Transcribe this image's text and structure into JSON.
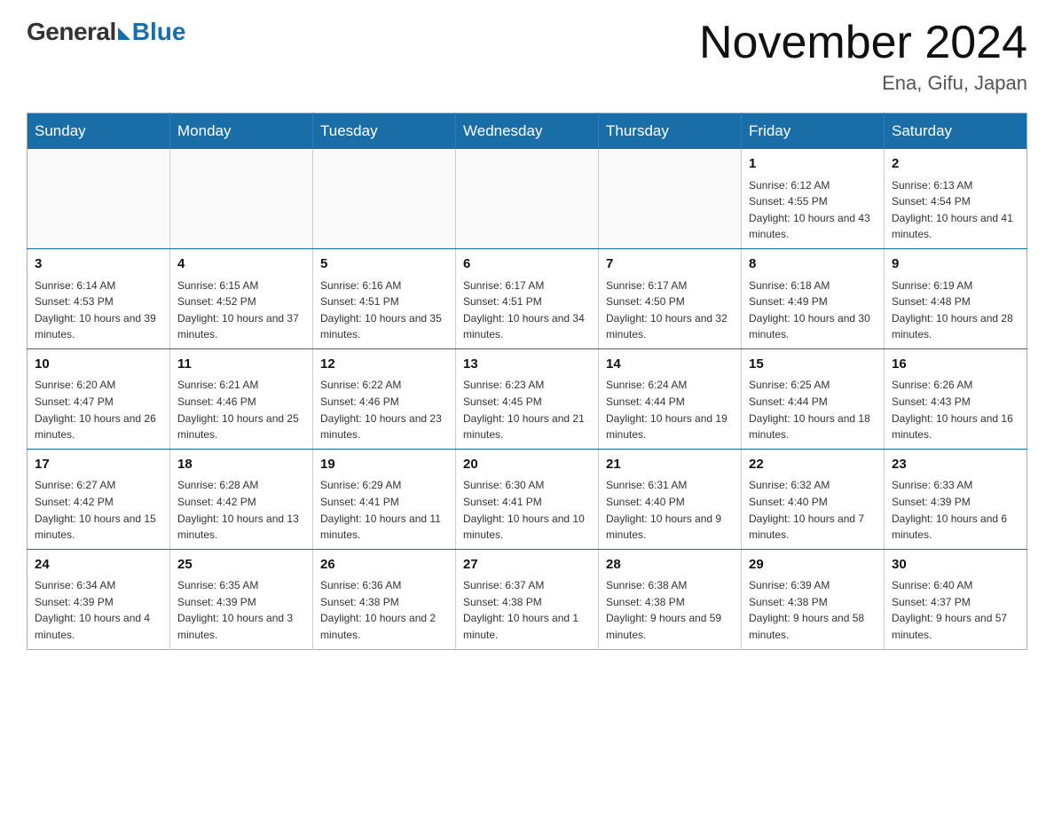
{
  "header": {
    "logo_general": "General",
    "logo_blue": "Blue",
    "month_title": "November 2024",
    "location": "Ena, Gifu, Japan"
  },
  "weekdays": [
    "Sunday",
    "Monday",
    "Tuesday",
    "Wednesday",
    "Thursday",
    "Friday",
    "Saturday"
  ],
  "weeks": [
    [
      {
        "day": "",
        "info": ""
      },
      {
        "day": "",
        "info": ""
      },
      {
        "day": "",
        "info": ""
      },
      {
        "day": "",
        "info": ""
      },
      {
        "day": "",
        "info": ""
      },
      {
        "day": "1",
        "info": "Sunrise: 6:12 AM\nSunset: 4:55 PM\nDaylight: 10 hours and 43 minutes."
      },
      {
        "day": "2",
        "info": "Sunrise: 6:13 AM\nSunset: 4:54 PM\nDaylight: 10 hours and 41 minutes."
      }
    ],
    [
      {
        "day": "3",
        "info": "Sunrise: 6:14 AM\nSunset: 4:53 PM\nDaylight: 10 hours and 39 minutes."
      },
      {
        "day": "4",
        "info": "Sunrise: 6:15 AM\nSunset: 4:52 PM\nDaylight: 10 hours and 37 minutes."
      },
      {
        "day": "5",
        "info": "Sunrise: 6:16 AM\nSunset: 4:51 PM\nDaylight: 10 hours and 35 minutes."
      },
      {
        "day": "6",
        "info": "Sunrise: 6:17 AM\nSunset: 4:51 PM\nDaylight: 10 hours and 34 minutes."
      },
      {
        "day": "7",
        "info": "Sunrise: 6:17 AM\nSunset: 4:50 PM\nDaylight: 10 hours and 32 minutes."
      },
      {
        "day": "8",
        "info": "Sunrise: 6:18 AM\nSunset: 4:49 PM\nDaylight: 10 hours and 30 minutes."
      },
      {
        "day": "9",
        "info": "Sunrise: 6:19 AM\nSunset: 4:48 PM\nDaylight: 10 hours and 28 minutes."
      }
    ],
    [
      {
        "day": "10",
        "info": "Sunrise: 6:20 AM\nSunset: 4:47 PM\nDaylight: 10 hours and 26 minutes."
      },
      {
        "day": "11",
        "info": "Sunrise: 6:21 AM\nSunset: 4:46 PM\nDaylight: 10 hours and 25 minutes."
      },
      {
        "day": "12",
        "info": "Sunrise: 6:22 AM\nSunset: 4:46 PM\nDaylight: 10 hours and 23 minutes."
      },
      {
        "day": "13",
        "info": "Sunrise: 6:23 AM\nSunset: 4:45 PM\nDaylight: 10 hours and 21 minutes."
      },
      {
        "day": "14",
        "info": "Sunrise: 6:24 AM\nSunset: 4:44 PM\nDaylight: 10 hours and 19 minutes."
      },
      {
        "day": "15",
        "info": "Sunrise: 6:25 AM\nSunset: 4:44 PM\nDaylight: 10 hours and 18 minutes."
      },
      {
        "day": "16",
        "info": "Sunrise: 6:26 AM\nSunset: 4:43 PM\nDaylight: 10 hours and 16 minutes."
      }
    ],
    [
      {
        "day": "17",
        "info": "Sunrise: 6:27 AM\nSunset: 4:42 PM\nDaylight: 10 hours and 15 minutes."
      },
      {
        "day": "18",
        "info": "Sunrise: 6:28 AM\nSunset: 4:42 PM\nDaylight: 10 hours and 13 minutes."
      },
      {
        "day": "19",
        "info": "Sunrise: 6:29 AM\nSunset: 4:41 PM\nDaylight: 10 hours and 11 minutes."
      },
      {
        "day": "20",
        "info": "Sunrise: 6:30 AM\nSunset: 4:41 PM\nDaylight: 10 hours and 10 minutes."
      },
      {
        "day": "21",
        "info": "Sunrise: 6:31 AM\nSunset: 4:40 PM\nDaylight: 10 hours and 9 minutes."
      },
      {
        "day": "22",
        "info": "Sunrise: 6:32 AM\nSunset: 4:40 PM\nDaylight: 10 hours and 7 minutes."
      },
      {
        "day": "23",
        "info": "Sunrise: 6:33 AM\nSunset: 4:39 PM\nDaylight: 10 hours and 6 minutes."
      }
    ],
    [
      {
        "day": "24",
        "info": "Sunrise: 6:34 AM\nSunset: 4:39 PM\nDaylight: 10 hours and 4 minutes."
      },
      {
        "day": "25",
        "info": "Sunrise: 6:35 AM\nSunset: 4:39 PM\nDaylight: 10 hours and 3 minutes."
      },
      {
        "day": "26",
        "info": "Sunrise: 6:36 AM\nSunset: 4:38 PM\nDaylight: 10 hours and 2 minutes."
      },
      {
        "day": "27",
        "info": "Sunrise: 6:37 AM\nSunset: 4:38 PM\nDaylight: 10 hours and 1 minute."
      },
      {
        "day": "28",
        "info": "Sunrise: 6:38 AM\nSunset: 4:38 PM\nDaylight: 9 hours and 59 minutes."
      },
      {
        "day": "29",
        "info": "Sunrise: 6:39 AM\nSunset: 4:38 PM\nDaylight: 9 hours and 58 minutes."
      },
      {
        "day": "30",
        "info": "Sunrise: 6:40 AM\nSunset: 4:37 PM\nDaylight: 9 hours and 57 minutes."
      }
    ]
  ]
}
